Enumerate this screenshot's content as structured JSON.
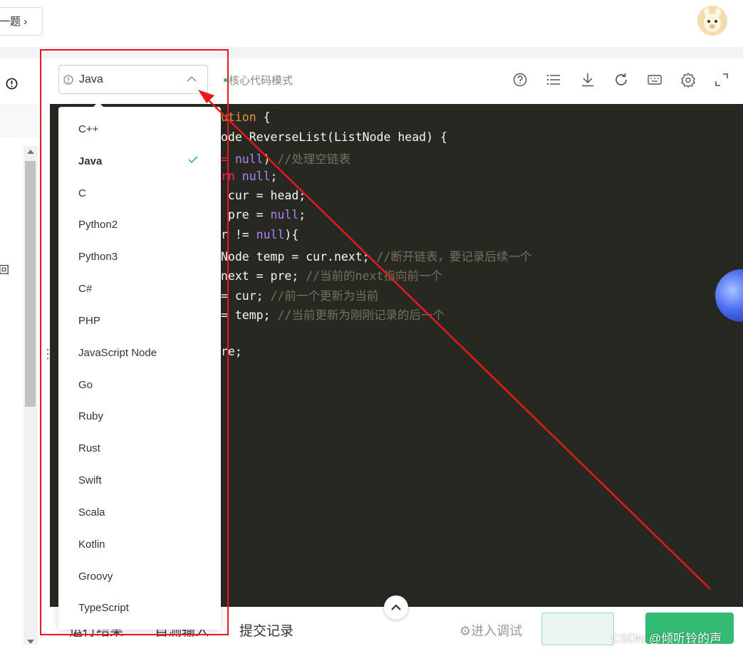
{
  "top": {
    "next_problem_label": "一题 ›"
  },
  "left": {
    "fragment_char": "回"
  },
  "editor_header": {
    "selected_language": "Java",
    "mode_label": "核心代码模式",
    "tools": [
      "help-icon",
      "list-icon",
      "download-icon",
      "refresh-icon",
      "keyboard-icon",
      "settings-icon",
      "fullscreen-icon"
    ]
  },
  "language_dropdown": {
    "options": [
      "C++",
      "Java",
      "C",
      "Python2",
      "Python3",
      "C#",
      "PHP",
      "JavaScript Node",
      "Go",
      "Ruby",
      "Rust",
      "Swift",
      "Scala",
      "Kotlin",
      "Groovy",
      "TypeScript"
    ],
    "selected": "Java"
  },
  "code": {
    "l1a": "ution",
    "l1b": " {",
    "l2": "ode ReverseList(ListNode head) {",
    "l3a": "= ",
    "l3b": "null",
    "l3c": ") ",
    "l3d": "//处理空链表",
    "l4a": "rn",
    "l4b": " null",
    "l4c": ";",
    "l5": " cur = head;",
    "l6a": " pre = ",
    "l6b": "null",
    "l6c": ";",
    "l7a": "r != ",
    "l7b": "null",
    "l7c": "){",
    "l8a": "Node temp = cur.next; ",
    "l8b": "//断开链表，要记录后续一个",
    "l9a": "next = pre; ",
    "l9b": "//当前的next指向前一个",
    "l10a": "= cur; ",
    "l10b": "//前一个更新为当前",
    "l11a": "= temp; ",
    "l11b": "//当前更新为刚刚记录的后一个",
    "l12": "re;"
  },
  "bottom": {
    "tab_results": "运行结果",
    "tab_custom_input": "自测输入",
    "tab_submissions": "提交记录",
    "debug_label": "进入调试"
  },
  "watermark": "CSDN @倾听铃的声",
  "colors": {
    "annotation_red": "#e8191a",
    "accent_green": "#33bb73",
    "editor_bg": "#272822"
  }
}
